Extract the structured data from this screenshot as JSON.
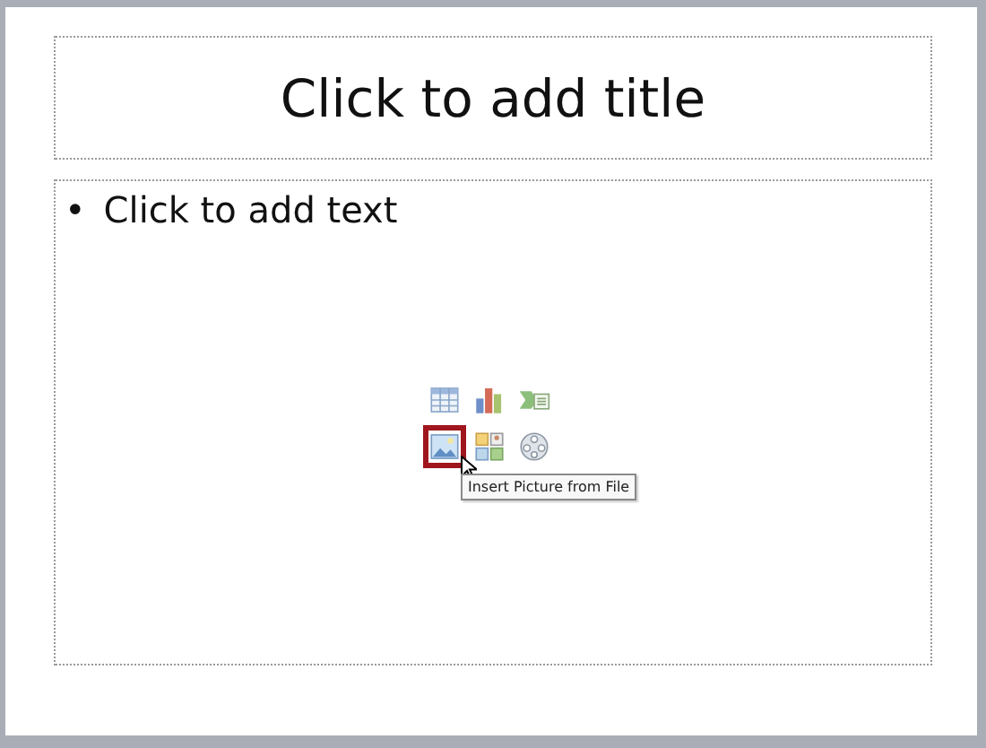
{
  "title_placeholder": {
    "text": "Click to add title"
  },
  "content_placeholder": {
    "bullet": "•",
    "text": "Click to add text",
    "insert_icons": [
      {
        "kind": "table",
        "selected": false
      },
      {
        "kind": "chart",
        "selected": false
      },
      {
        "kind": "smartart",
        "selected": false
      },
      {
        "kind": "picture",
        "selected": true
      },
      {
        "kind": "clipart",
        "selected": false
      },
      {
        "kind": "media",
        "selected": false
      }
    ],
    "tooltip": "Insert Picture from File"
  }
}
